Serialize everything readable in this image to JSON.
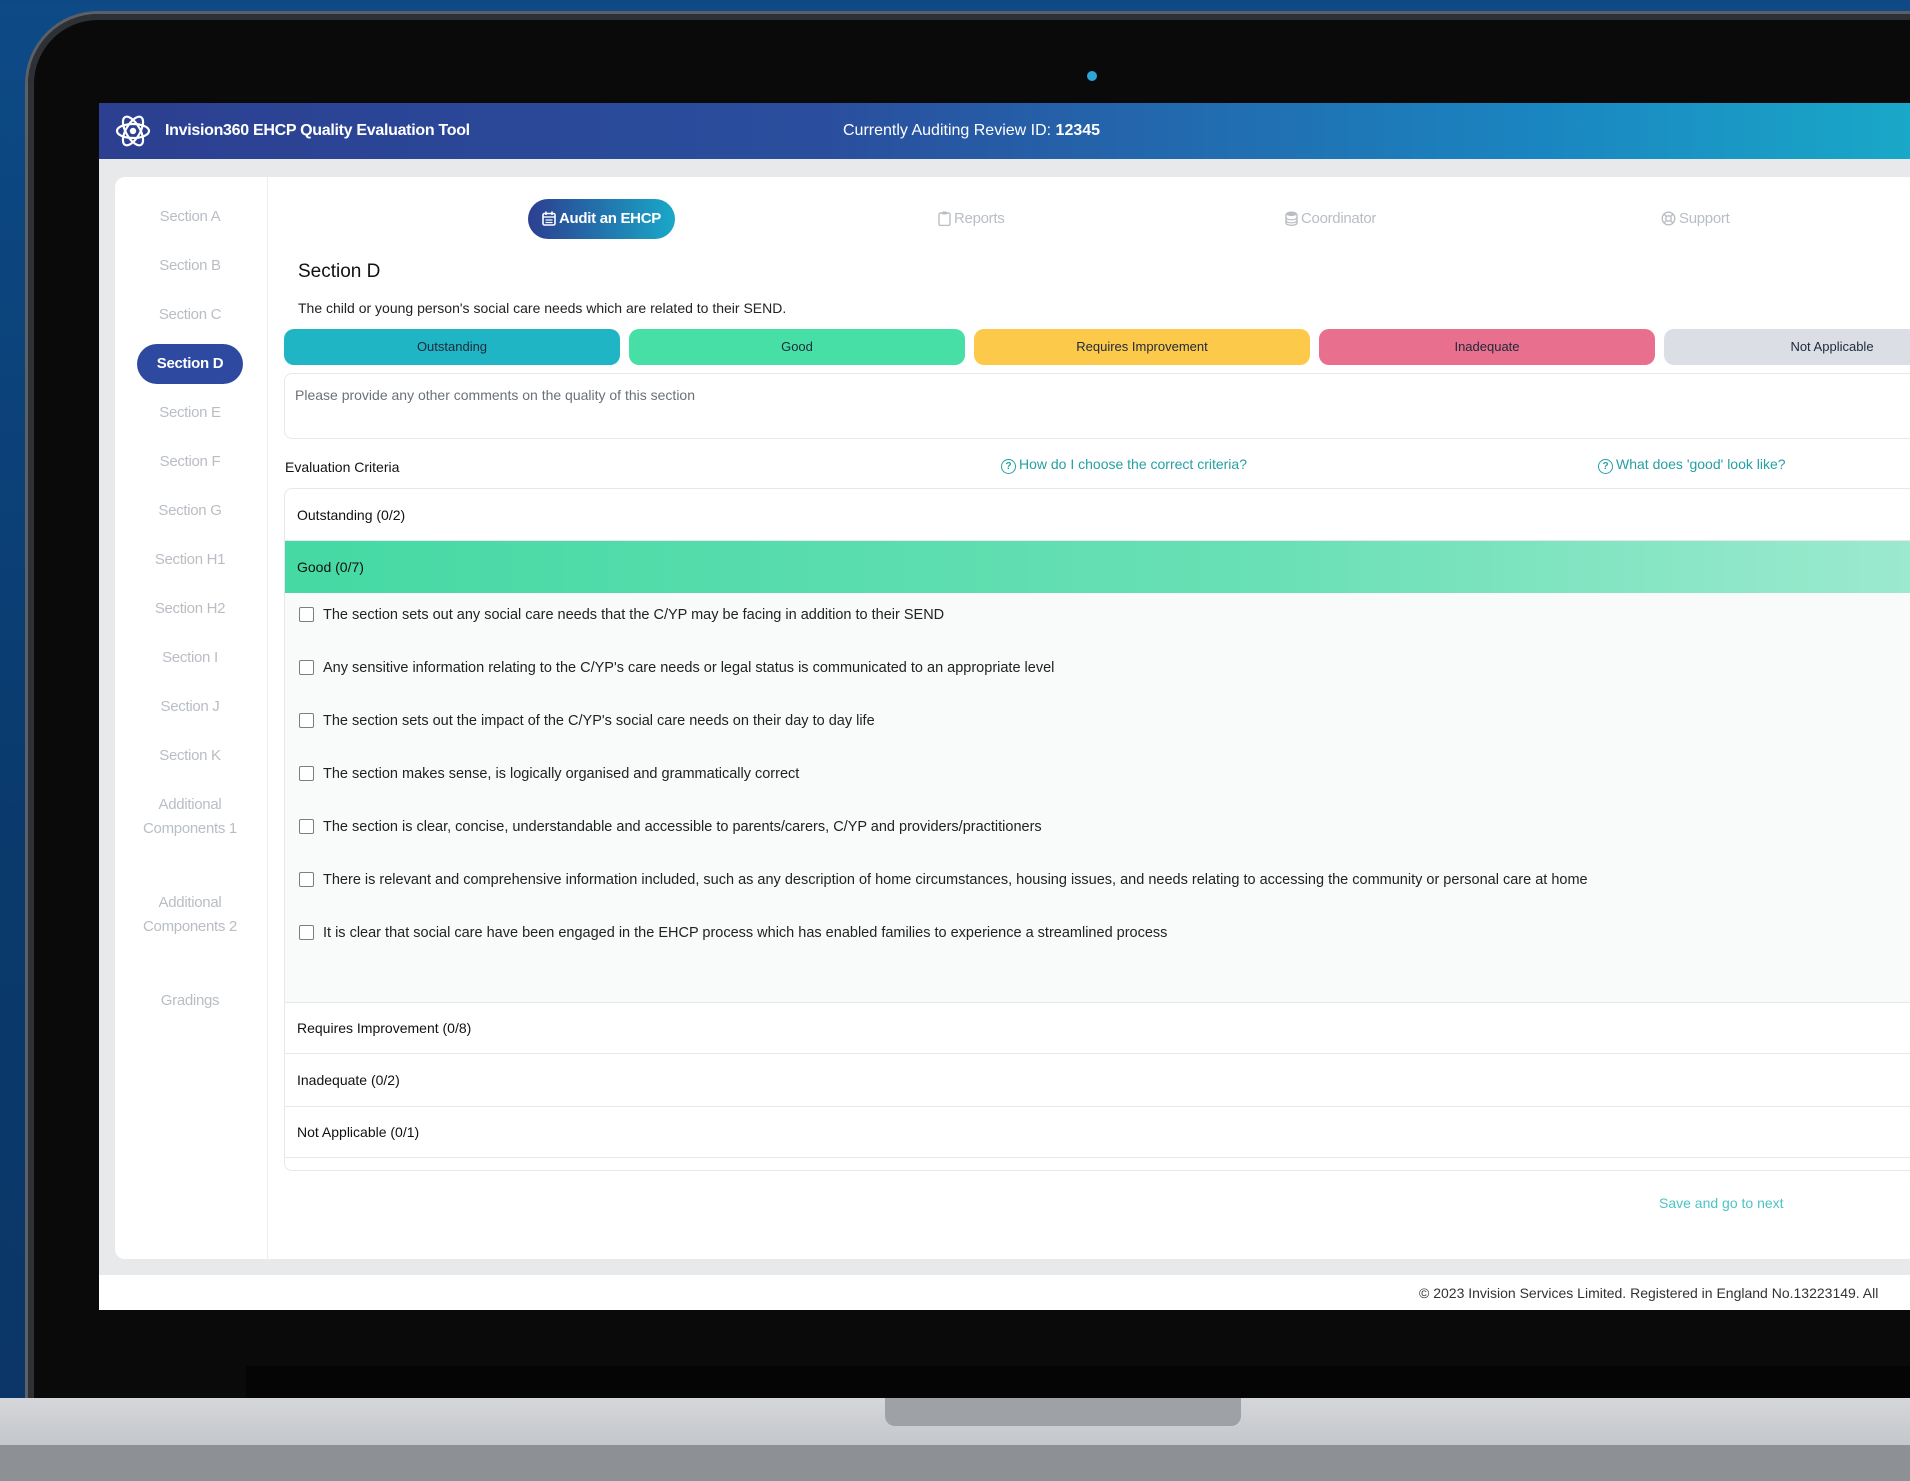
{
  "header": {
    "app_title": "Invision360 EHCP Quality Evaluation Tool",
    "audit_prefix": "Currently Auditing Review ID:",
    "review_id": "12345"
  },
  "sidebar": {
    "items": [
      {
        "label": "Section A"
      },
      {
        "label": "Section B"
      },
      {
        "label": "Section C"
      },
      {
        "label": "Section D",
        "active": true
      },
      {
        "label": "Section E"
      },
      {
        "label": "Section F"
      },
      {
        "label": "Section G"
      },
      {
        "label": "Section H1"
      },
      {
        "label": "Section H2"
      },
      {
        "label": "Section I"
      },
      {
        "label": "Section J"
      },
      {
        "label": "Section K"
      },
      {
        "label": "Additional Components 1"
      },
      {
        "label": "Additional Components 2"
      },
      {
        "label": "Gradings"
      }
    ]
  },
  "tabs": [
    {
      "label": "Audit an EHCP",
      "icon": "calendar-icon",
      "active": true
    },
    {
      "label": "Reports",
      "icon": "clipboard-icon"
    },
    {
      "label": "Coordinator",
      "icon": "database-icon"
    },
    {
      "label": "Support",
      "icon": "lifebuoy-icon"
    }
  ],
  "section": {
    "title": "Section D",
    "description": "The child or young person's social care needs which are related to their SEND."
  },
  "grades": [
    {
      "label": "Outstanding",
      "color": "#1fb5c4"
    },
    {
      "label": "Good",
      "color": "#47dfa6"
    },
    {
      "label": "Requires Improvement",
      "color": "#fdc94a"
    },
    {
      "label": "Inadequate",
      "color": "#e86f8d"
    },
    {
      "label": "Not Applicable",
      "color": "#dcdee6"
    }
  ],
  "comments": {
    "placeholder": "Please provide any other comments on the quality of this section"
  },
  "criteria": {
    "label": "Evaluation Criteria",
    "help_choose": "How do I choose the correct criteria?",
    "help_good": "What does 'good' look like?",
    "groups": [
      {
        "label": "Outstanding (0/2)"
      },
      {
        "label": "Good (0/7)",
        "open": true
      },
      {
        "label": "Requires Improvement (0/8)"
      },
      {
        "label": "Inadequate (0/2)"
      },
      {
        "label": "Not Applicable (0/1)"
      }
    ],
    "good_items": [
      {
        "text": "The section sets out any social care needs that the C/YP may be facing in addition to their SEND",
        "checked": false
      },
      {
        "text": "Any sensitive information relating to the C/YP's care needs or legal status is communicated to an appropriate level",
        "checked": false
      },
      {
        "text": "The section sets out the impact of the C/YP's social care needs on their day to day life",
        "checked": false
      },
      {
        "text": "The section makes sense, is logically organised and grammatically correct",
        "checked": false
      },
      {
        "text": "The section is clear, concise, understandable and accessible to parents/carers, C/YP and providers/practitioners",
        "checked": false
      },
      {
        "text": "There is relevant and comprehensive information included, such as any description of home circumstances, housing issues, and needs relating to accessing the community or personal care at home",
        "checked": false
      },
      {
        "text": "It is clear that social care have been engaged in the EHCP process which has enabled families to experience a streamlined process",
        "checked": false
      }
    ]
  },
  "actions": {
    "save_next": "Save and go to next"
  },
  "footer": {
    "copyright": "© 2023 Invision Services Limited. Registered in England No.13223149. All"
  }
}
